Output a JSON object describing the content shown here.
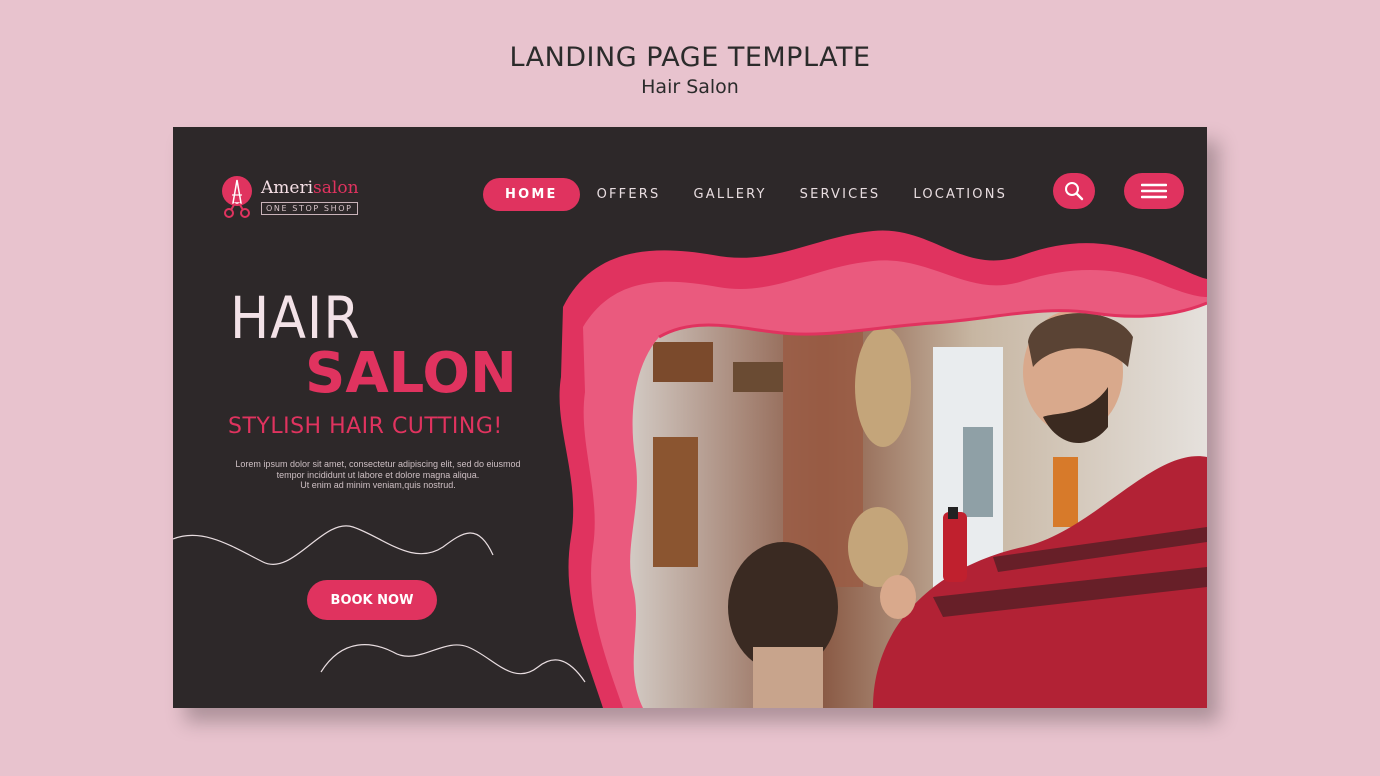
{
  "page": {
    "title": "LANDING PAGE TEMPLATE",
    "subtitle": "Hair Salon"
  },
  "logo": {
    "brand_part1": "Ameri",
    "brand_part2": "salon",
    "tagline": "ONE STOP SHOP",
    "icon": "eiffel-scissors-icon"
  },
  "nav": {
    "items": [
      "HOME",
      "OFFERS",
      "GALLERY",
      "SERVICES",
      "LOCATIONS"
    ],
    "active": "HOME"
  },
  "actions": {
    "search_icon": "search-icon",
    "menu_icon": "hamburger-menu-icon"
  },
  "hero": {
    "title_line1": "HAIR",
    "title_line2": "SALON",
    "subtitle": "STYLISH HAIR CUTTING!",
    "description_line1": "Lorem ipsum dolor sit amet, consectetur adipiscing elit, sed do eiusmod",
    "description_line2": "tempor incididunt ut labore et dolore magna aliqua.",
    "description_line3": "Ut enim ad minim veniam,quis nostrud.",
    "cta_label": "BOOK NOW"
  },
  "colors": {
    "background": "#e8c3ce",
    "panel": "#2d2829",
    "accent": "#e0335f",
    "accent_light": "#ea5a7e"
  }
}
